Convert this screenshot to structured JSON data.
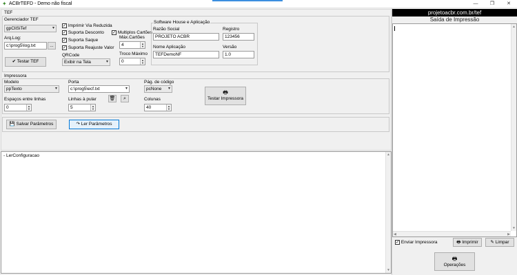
{
  "window": {
    "title": "ACBrTEFD - Demo não fiscal",
    "minimize": "—",
    "restore": "❐",
    "close": "✕"
  },
  "tef": {
    "frame_title": "TEF",
    "gerenciador_label": "Gerenciador TEF",
    "gerenciador_value": "gpCliSiTef",
    "arqlog_label": "Arq.Log:",
    "arqlog_value": "c:\\prog5\\log.txt",
    "browse_label": "...",
    "testar_label": "Testar TEF",
    "imprimir_via_reduzida": "Imprimir Via Reduzida",
    "suporta_desconto": "Suporta Desconto",
    "suporta_saque": "Suporta Saque",
    "suporta_reajuste": "Suporta Reajuste Valor",
    "multiplos_cartoes": "Multiplos Cartões",
    "max_cartoes_label": "Máx.Cartões",
    "max_cartoes_value": "4",
    "qrcode_label": "QRCode",
    "qrcode_value": "Exibir na Tela",
    "troco_label": "Troco Máximo",
    "troco_value": "0"
  },
  "software_house": {
    "frame_title": "Software House e Aplicação",
    "razao_label": "Razão Social",
    "razao_value": "PROJETO ACBR",
    "registro_label": "Registro",
    "registro_value": "123456",
    "nome_app_label": "Nome Aplicação",
    "nome_app_value": "TEFDemoNF",
    "versao_label": "Versão",
    "versao_value": "1.0"
  },
  "impressora": {
    "frame_title": "Impressora",
    "modelo_label": "Modelo",
    "modelo_value": "ppTexto",
    "porta_label": "Porta",
    "porta_value": "c:\\prog5\\ecf.txt",
    "pag_codigo_label": "Pág. de código",
    "pag_codigo_value": "pcNone",
    "espacos_label": "Espaços entre linhas",
    "espacos_value": "0",
    "linhas_label": "Linhas à pular",
    "linhas_value": "5",
    "colunas_label": "Colunas",
    "colunas_value": "40",
    "testar_label": "Testar Impressora"
  },
  "params": {
    "salvar_label": "Salvar Parâmetros",
    "ler_label": "Ler Parâmetros"
  },
  "log": {
    "lines": [
      "- LerConfiguracao"
    ]
  },
  "right_panel": {
    "header": "projetoacbr.com.br/tef",
    "subtitle": "Saída de Impressão",
    "enviar_label": "Enviar Impressora",
    "imprimir_label": "Imprimir",
    "limpar_label": "Limpar",
    "operacoes_label": "Operações"
  },
  "icons": {
    "check": "✓",
    "dropdown": "▾",
    "spin_up": "▲",
    "spin_down": "▼"
  },
  "colors": {
    "accent": "#0078d7",
    "header_bg": "#000000",
    "window_bg": "#f0f0f0"
  }
}
